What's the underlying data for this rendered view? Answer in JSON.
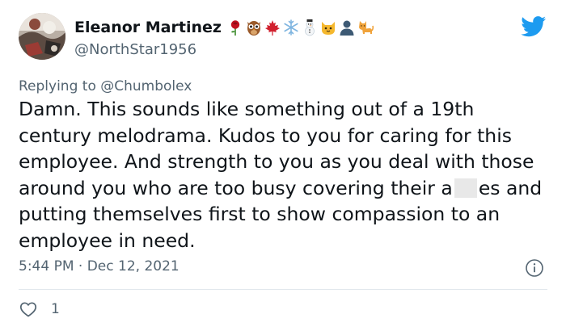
{
  "author": {
    "display_name": "Eleanor Martinez",
    "handle": "@NorthStar1956",
    "name_emojis": [
      "rose-icon",
      "owl-icon",
      "maple-leaf-icon",
      "snowflake-icon",
      "snowman-icon",
      "cat-face-icon",
      "person-silhouette-icon",
      "cat-icon"
    ]
  },
  "reply": {
    "prefix": "Replying to",
    "mention": "@Chumbolex"
  },
  "tweet": {
    "text_before": "Damn. This sounds like something out of a 19th century melodrama. Kudos to you for caring for this employee. And strength to you as you deal with those around you who are too busy covering their a",
    "text_after": "es and putting themselves first to show compassion to an employee in need.",
    "timestamp": "5:44 PM · Dec 12, 2021",
    "likes": "1"
  },
  "colors": {
    "twitter_blue": "#1d9bf0",
    "secondary_text": "#536471",
    "primary_text": "#0f1419"
  }
}
